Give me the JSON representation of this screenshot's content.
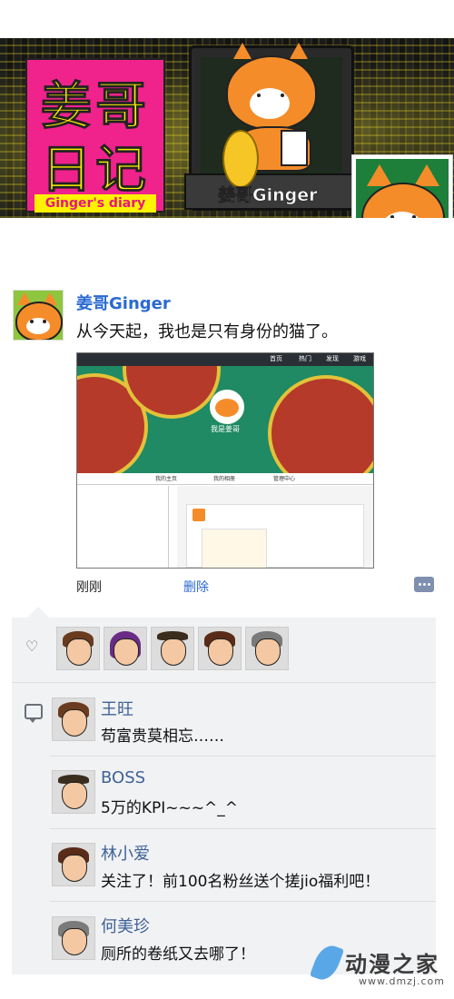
{
  "cover": {
    "logo_line1": "姜哥",
    "logo_line2": "日记",
    "logo_sub": "Ginger's diary",
    "name_caption": "姜哥Ginger"
  },
  "post": {
    "author": "姜哥Ginger",
    "text": "从今天起，我也是只有身份的猫了。",
    "image": {
      "topbar_items": [
        "首页",
        "热门",
        "发现",
        "游戏"
      ],
      "profile_name": "我是姜哥",
      "tabs": [
        "我的主页",
        "我的相册",
        "管理中心"
      ]
    },
    "time": "刚刚",
    "delete_label": "删除"
  },
  "likes": {
    "avatars": [
      "avatar-man",
      "avatar-woman-purple",
      "avatar-boss",
      "avatar-girl",
      "avatar-old-woman"
    ]
  },
  "comments": [
    {
      "name": "王旺",
      "text": "苟富贵莫相忘……"
    },
    {
      "name": "BOSS",
      "text": "5万的KPI~~~^_^"
    },
    {
      "name": "林小爱",
      "text": "关注了！前100名粉丝送个搓jio福利吧！"
    },
    {
      "name": "何美珍",
      "text": "厕所的卷纸又去哪了！"
    }
  ],
  "watermark": {
    "text": "动漫之家",
    "url": "www.dmzj.com"
  },
  "colors": {
    "link_blue": "#2a6ad1",
    "comment_name": "#3f6196",
    "panel_bg": "#f1f2f4",
    "logo_pink": "#f0228c",
    "logo_yellow": "#fff200"
  }
}
